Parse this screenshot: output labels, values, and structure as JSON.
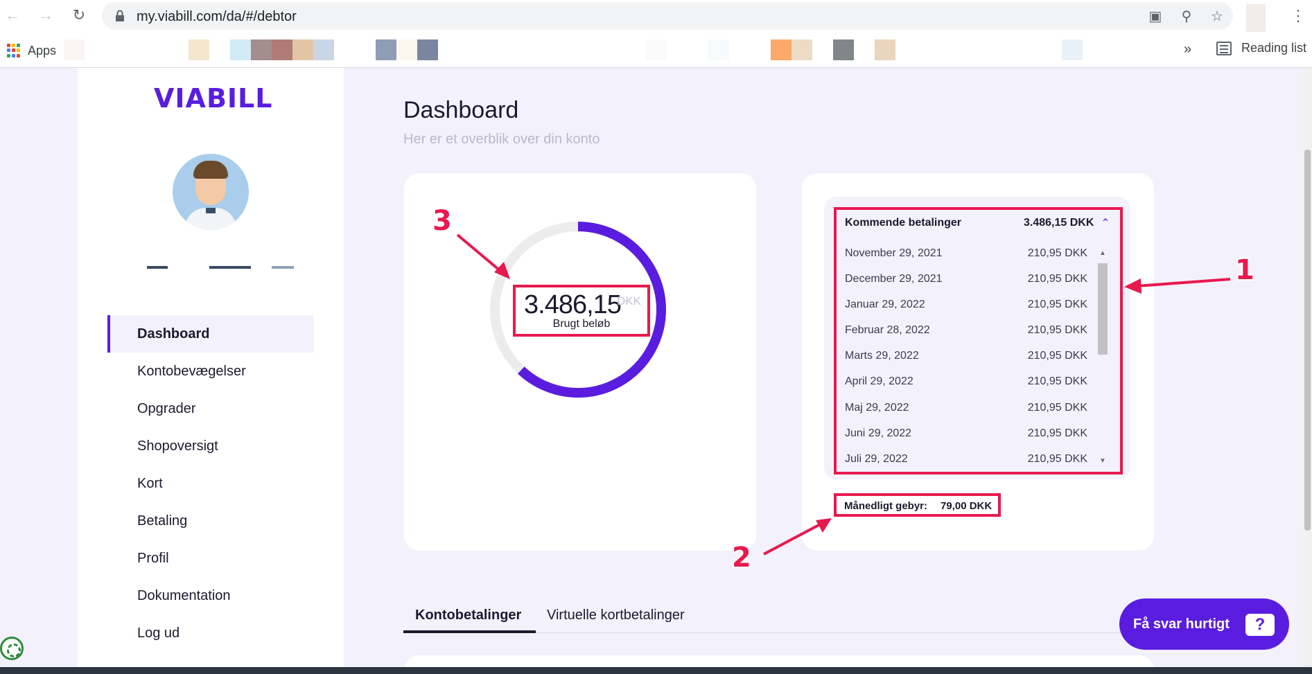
{
  "browser": {
    "url": "my.viabill.com/da/#/debtor",
    "apps_label": "Apps",
    "more_label": "»",
    "reading_list_label": "Reading list"
  },
  "sidebar": {
    "logo_text": "VIABILL",
    "menu": [
      {
        "label": "Dashboard",
        "active": true
      },
      {
        "label": "Kontobevægelser"
      },
      {
        "label": "Opgrader"
      },
      {
        "label": "Shopoversigt"
      },
      {
        "label": "Kort"
      },
      {
        "label": "Betaling"
      },
      {
        "label": "Profil"
      },
      {
        "label": "Dokumentation"
      },
      {
        "label": "Log ud"
      }
    ]
  },
  "dashboard": {
    "title": "Dashboard",
    "subtitle": "Her er et overblik over din konto",
    "spent": {
      "value": "3.486,15",
      "currency": "DKK",
      "label": "Brugt beløb",
      "gauge_fraction": 0.62
    },
    "upcoming": {
      "title": "Kommende betalinger",
      "total": "3.486,15 DKK",
      "payments": [
        {
          "date": "November 29, 2021",
          "amount": "210,95 DKK"
        },
        {
          "date": "December 29, 2021",
          "amount": "210,95 DKK"
        },
        {
          "date": "Januar 29, 2022",
          "amount": "210,95 DKK"
        },
        {
          "date": "Februar 28, 2022",
          "amount": "210,95 DKK"
        },
        {
          "date": "Marts 29, 2022",
          "amount": "210,95 DKK"
        },
        {
          "date": "April 29, 2022",
          "amount": "210,95 DKK"
        },
        {
          "date": "Maj 29, 2022",
          "amount": "210,95 DKK"
        },
        {
          "date": "Juni 29, 2022",
          "amount": "210,95 DKK"
        },
        {
          "date": "Juli 29, 2022",
          "amount": "210,95 DKK"
        }
      ]
    },
    "monthly_fee": {
      "label": "Månedligt gebyr:",
      "value": "79,00 DKK"
    }
  },
  "tabs": [
    {
      "label": "Kontobetalinger",
      "active": true
    },
    {
      "label": "Virtuelle kortbetalinger"
    }
  ],
  "help": {
    "label": "Få svar hurtigt",
    "icon_text": "?"
  },
  "annotations": [
    "1",
    "2",
    "3"
  ],
  "colors": {
    "brand": "#5a1ddf",
    "annotation": "#e8194f",
    "gauge_track": "#ececec"
  }
}
